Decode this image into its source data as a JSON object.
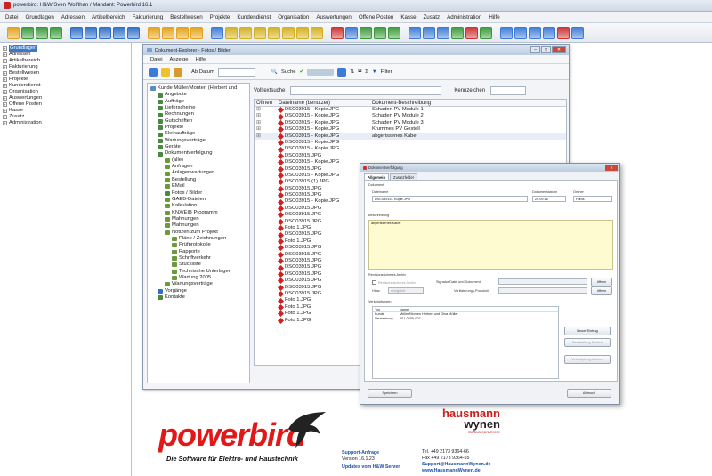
{
  "app_title": "powerbird: H&W Sven Wolfthan / Mandant: Powerbird 16.1",
  "menu": [
    "Datei",
    "Grundlagen",
    "Adressen",
    "Artikelbereich",
    "Fakturierung",
    "Bestellwesen",
    "Projekte",
    "Kundendienst",
    "Organisation",
    "Auswertungen",
    "Offene Posten",
    "Kasse",
    "Zusatz",
    "Administration",
    "Hilfe"
  ],
  "sidebar": [
    "Grundlagen",
    "Adressen",
    "Artikelbereich",
    "Fakturierung",
    "Bestellwesen",
    "Projekte",
    "Kundendienst",
    "Organisation",
    "Auswertungen",
    "Offene Posten",
    "Kasse",
    "Zusatz",
    "Administration"
  ],
  "explorer": {
    "title": "Dokument-Explorer - Fotos / Bilder",
    "menu": [
      "Datei",
      "Anzeige",
      "Hilfe"
    ],
    "ab_datum": "Ab Datum",
    "suche": "Suche",
    "filter": "Filter",
    "root": "Kunde Müller/Monten (Herbert und",
    "tree_items": [
      "Angebote",
      "Aufträge",
      "Lieferscheine",
      "Rechnungen",
      "Gutschriften",
      "Projekte",
      "Kleinaufträge",
      "Wartungsverträge",
      "Geräte",
      "Dokumentverfolgung",
      "(alle)",
      "Anfragen",
      "Anlagenwartungen",
      "Bestellung",
      "EMail",
      "Fotos / Bilder",
      "GAEB-Dateien",
      "Kalkulation",
      "KNX/EIB Programm",
      "Mahnungen",
      "Mahnungen",
      "Notizen zum Projekt",
      "Pläne / Zeichnungen",
      "Prüfprotokolle",
      "Rapporte",
      "Schriftverkehr",
      "Stückliste",
      "Technische Unterlagen",
      "Wartung 2005",
      "Wartungsverträge",
      "Vorgänge",
      "Kontakte"
    ],
    "volltext_label": "Volltextsuche",
    "kennzeichen_label": "Kennzeichen",
    "columns": [
      "Öffnen",
      "Dateiname (benutzer)",
      "Dokument-Beschreibung"
    ],
    "rows": [
      [
        "DSC03915 - Kopie.JPG",
        "Schaden PV Module 1"
      ],
      [
        "DSC03915 - Kopie.JPG",
        "Schaden PV Module 2"
      ],
      [
        "DSC03915 - Kopie.JPG",
        "Schaden PV Module 3"
      ],
      [
        "DSC03915 - Kopie.JPG",
        "Krummes PV Gestell"
      ],
      [
        "DSC03915 - Kopie.JPG",
        "abgerissenes Kabel"
      ],
      [
        "DSC03915 - Kopie.JPG",
        ""
      ],
      [
        "DSC03915 - Kopie.JPG",
        ""
      ],
      [
        "DSC03915.JPG",
        ""
      ],
      [
        "DSC03915 - Kopie.JPG",
        ""
      ],
      [
        "DSC03915.JPG",
        ""
      ],
      [
        "DSC03915 - Kopie.JPG",
        ""
      ],
      [
        "DSC03915 (1).JPG",
        ""
      ],
      [
        "DSC03915.JPG",
        ""
      ],
      [
        "DSC03915.JPG",
        ""
      ],
      [
        "DSC03915 - Kopie.JPG",
        ""
      ],
      [
        "DSC03915.JPG",
        ""
      ],
      [
        "DSC03915.JPG",
        ""
      ],
      [
        "DSC03915.JPG",
        ""
      ],
      [
        "Foto 1.JPG",
        ""
      ],
      [
        "DSC03915.JPG",
        ""
      ],
      [
        "Foto 1.JPG",
        ""
      ],
      [
        "DSC03915.JPG",
        ""
      ],
      [
        "DSC03915.JPG",
        ""
      ],
      [
        "DSC03915.JPG",
        ""
      ],
      [
        "DSC03915.JPG",
        ""
      ],
      [
        "DSC03915.JPG",
        ""
      ],
      [
        "DSC03915.JPG",
        ""
      ],
      [
        "DSC03915.JPG",
        ""
      ],
      [
        "DSC03915.JPG",
        ""
      ],
      [
        "Foto 1.JPG",
        ""
      ],
      [
        "Foto 1.JPG",
        ""
      ],
      [
        "Foto 1.JPG",
        ""
      ],
      [
        "Foto 1.JPG",
        ""
      ]
    ]
  },
  "dialog": {
    "title": "Dokumentverfolgung",
    "tabs": [
      "Allgemein",
      "Zusatzfelder"
    ],
    "dokument_label": "Dokument",
    "dateiname_label": "Dateiname",
    "dateiname_value": "DSC03915 - Kopie.JPG",
    "datum_label": "Dokumentdatum",
    "datum_value": "20.09.16",
    "ordner_label": "Ordner",
    "ordner_value": "Fotos",
    "beschreibung_label": "Beschreibung",
    "beschreibung_value": "abgerissenes Kabel",
    "archiv_label": "Revisionssicheres Archiv",
    "archiv_check": "Revisionssicheres Archiv",
    "signatur_label": "Signatur Datei und Dokument",
    "protokoll_label": "Verifizierungs-Protokoll",
    "oeffnen": "öffnen",
    "hinw_label": "Hinw.",
    "hinw_value": "unsigniert",
    "verknuepfungen_label": "Verknüpfungen",
    "link_cols": [
      "Typ",
      "Name"
    ],
    "link_rows": [
      [
        "Kunde",
        "Müller/Monten Herbert und Gina Müller"
      ],
      [
        "Vermerkung",
        "001-0005-007"
      ]
    ],
    "btn_neuer": "Neuer Eintrag",
    "btn_aendern": "Bearbeitung Ändern",
    "btn_loeschen": "Verknüpfung löschen",
    "btn_speichern": "Speichern",
    "btn_abbruch": "Abbruch"
  },
  "footer": {
    "logo": "powerbird",
    "tagline": "Die Software für Elektro- und Haustechnik",
    "support_title": "Support-Anfrage",
    "version": "Version 16.1.23",
    "updates": "Updates vom H&W Server",
    "hm_line1": "hausmann",
    "hm_line2": "wynen",
    "hm_line3": "Softwareprozesse",
    "tel": "Tel.   +49 2173 9364-66",
    "fax": "Fax   +49 2173 9364-55",
    "email": "Support@HausmannWynen.de",
    "web": "www.HausmannWynen.de"
  },
  "colors": {
    "accent": "#3a78c8",
    "brand_red": "#e01818",
    "link": "#1c4ea6",
    "desc_bg": "#fffbd0"
  }
}
